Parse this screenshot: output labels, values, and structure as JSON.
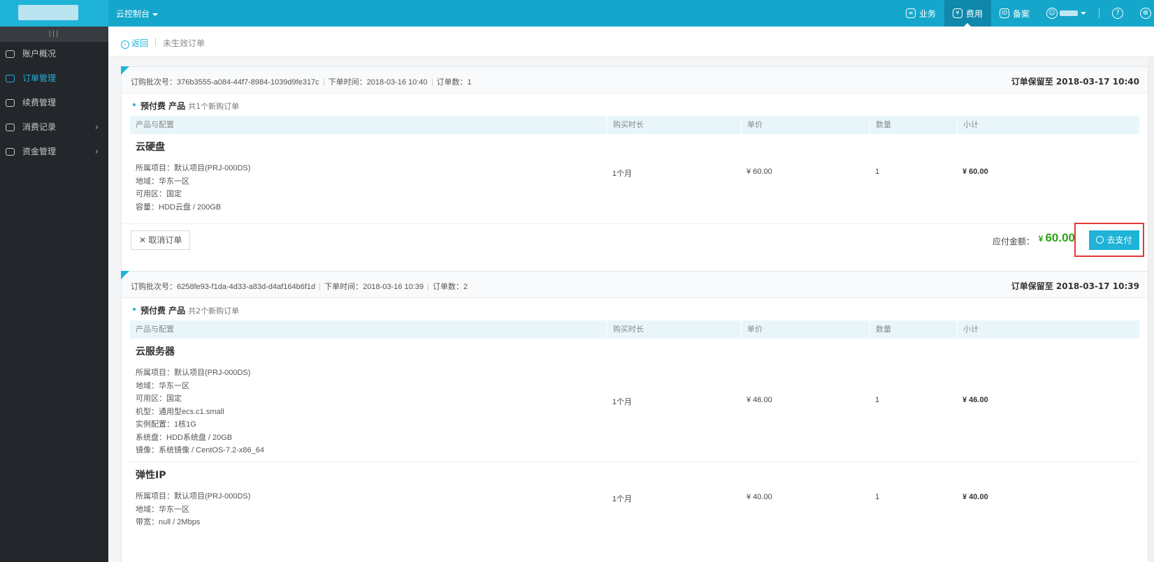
{
  "topbar": {
    "console_label": "云控制台",
    "nav": [
      {
        "label": "业务",
        "icon": "business-icon",
        "active": false
      },
      {
        "label": "费用",
        "icon": "cost-icon",
        "active": true
      },
      {
        "label": "备案",
        "icon": "record-filing-icon",
        "active": false
      }
    ]
  },
  "sidebar": {
    "items": [
      {
        "label": "账户概况",
        "icon": "dashboard-icon",
        "active": false,
        "arrow": false
      },
      {
        "label": "订单管理",
        "icon": "order-icon",
        "active": true,
        "arrow": false
      },
      {
        "label": "续费管理",
        "icon": "renew-icon",
        "active": false,
        "arrow": false
      },
      {
        "label": "消费记录",
        "icon": "consumption-icon",
        "active": false,
        "arrow": true
      },
      {
        "label": "资金管理",
        "icon": "wallet-icon",
        "active": false,
        "arrow": true
      }
    ]
  },
  "breadcrumb": {
    "back_label": "返回",
    "title": "未生效订单"
  },
  "table_headers": [
    "产品与配置",
    "购买时长",
    "单价",
    "数量",
    "小计"
  ],
  "orders": [
    {
      "batch_label": "订购批次号：",
      "batch_id": "376b3555-a084-44f7-8984-1039d9fe317c",
      "time_label": "下单时间：",
      "time": "2018-03-16 10:40",
      "count_label": "订单数：",
      "count": "1",
      "hold_text": "订单保留至 2018-03-17 10:40",
      "section_title": "预付费 产品",
      "section_count": "共1个新购订单",
      "products": [
        {
          "name": "云硬盘",
          "specs": [
            "所属项目：默认项目(PRJ-000DS)",
            "地域：华东一区",
            "可用区：国定",
            "容量：HDD云盘 / 200GB"
          ],
          "duration": "1个月",
          "unit_price": "¥ 60.00",
          "quantity": "1",
          "subtotal": "¥ 60.00"
        }
      ],
      "cancel_label": "取消订单",
      "pay_label": "应付金额：",
      "pay_currency": "¥",
      "pay_amount": "60.00",
      "pay_button": "去支付"
    },
    {
      "batch_label": "订购批次号：",
      "batch_id": "6258fe93-f1da-4d33-a83d-d4af164b6f1d",
      "time_label": "下单时间：",
      "time": "2018-03-16 10:39",
      "count_label": "订单数：",
      "count": "2",
      "hold_text": "订单保留至 2018-03-17 10:39",
      "section_title": "预付费 产品",
      "section_count": "共2个新购订单",
      "products": [
        {
          "name": "云服务器",
          "specs": [
            "所属项目：默认项目(PRJ-000DS)",
            "地域：华东一区",
            "可用区：国定",
            "机型：通用型ecs.c1.small",
            "实例配置：1核1G",
            "系统盘：HDD系统盘 / 20GB",
            "镜像：系统镜像 / CentOS-7.2-x86_64"
          ],
          "duration": "1个月",
          "unit_price": "¥ 46.00",
          "quantity": "1",
          "subtotal": "¥ 46.00"
        },
        {
          "name": "弹性IP",
          "specs": [
            "所属项目：默认项目(PRJ-000DS)",
            "地域：华东一区",
            "带宽：null / 2Mbps"
          ],
          "duration": "1个月",
          "unit_price": "¥ 40.00",
          "quantity": "1",
          "subtotal": "¥ 40.00"
        }
      ]
    }
  ]
}
